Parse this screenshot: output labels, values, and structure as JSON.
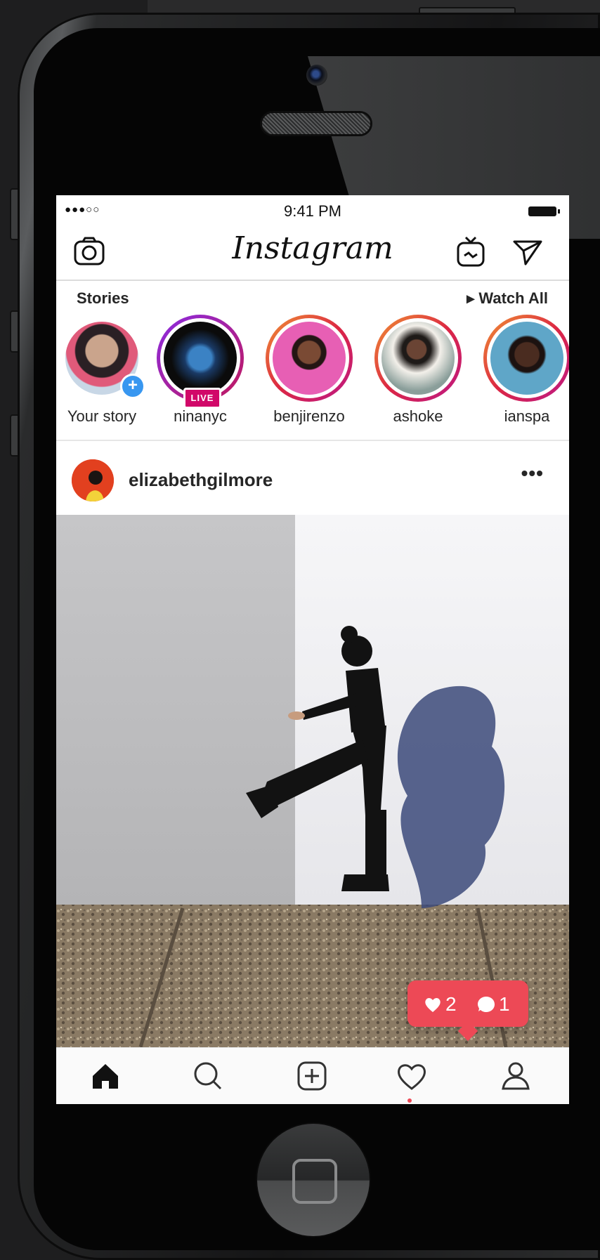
{
  "status_bar": {
    "signal": "●●●○○",
    "time": "9:41 PM"
  },
  "nav": {
    "logo": "Instagram",
    "icons": [
      "camera-icon",
      "igtv-icon",
      "direct-send-icon"
    ]
  },
  "stories": {
    "title": "Stories",
    "watch_all": "▸ Watch All",
    "items": [
      {
        "label": "Your story",
        "badge": "+"
      },
      {
        "label": "ninanyc",
        "badge": "LIVE"
      },
      {
        "label": "benjirenzo"
      },
      {
        "label": "ashoke"
      },
      {
        "label": "ianspa"
      }
    ]
  },
  "post": {
    "username": "elizabethgilmore",
    "more": "•••"
  },
  "notification": {
    "likes": "2",
    "comments": "1"
  },
  "tab_bar": {
    "icons": [
      "home-icon",
      "search-icon",
      "add-post-icon",
      "activity-heart-icon",
      "profile-icon"
    ]
  },
  "colors": {
    "accent_red": "#ed4956",
    "live_pink": "#d10869",
    "blue_badge": "#3897f0"
  }
}
